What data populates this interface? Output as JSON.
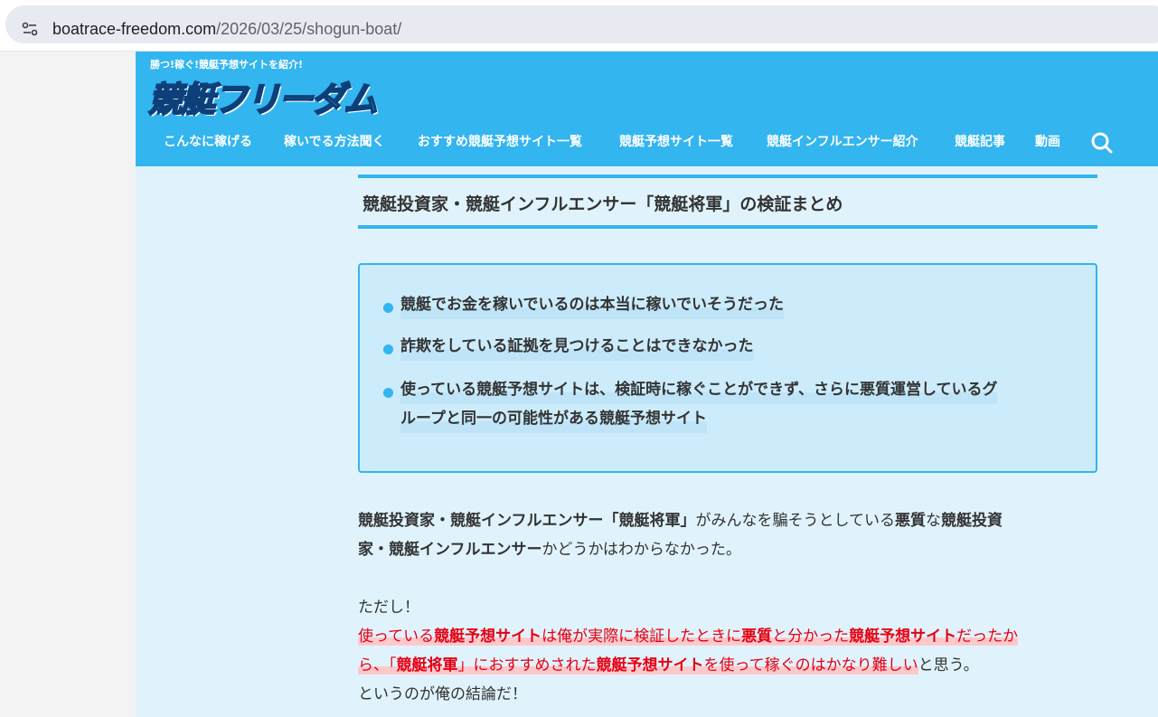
{
  "browser": {
    "url_host": "boatrace-freedom.com",
    "url_path": "/2026/03/25/shogun-boat/"
  },
  "site": {
    "tagline": "勝つ!稼ぐ!競艇予想サイトを紹介!",
    "logo_text_1": "競艇",
    "logo_text_2": "フリーダム",
    "nav": [
      {
        "label": "こんなに稼げる"
      },
      {
        "label": "稼いでる方法聞く"
      },
      {
        "label": "おすすめ競艇予想サイト一覧"
      },
      {
        "label": "競艇予想サイト一覧"
      },
      {
        "label": "競艇インフルエンサー紹介"
      },
      {
        "label": "競艇記事"
      },
      {
        "label": "動画"
      }
    ],
    "accent_color": "#33b5ef"
  },
  "article": {
    "heading": "競艇投資家・競艇インフルエンサー「競艇将軍」の検証まとめ",
    "summary": [
      "競艇でお金を稼いでいるのは本当に稼いでいそうだった",
      "詐欺をしている証拠を見つけることはできなかった",
      "使っている競艇予想サイトは、検証時に稼ぐことができず、さらに悪質運営しているグ",
      "ループと同一の可能性がある競艇予想サイト"
    ],
    "p1": {
      "a": "競艇投資家・競艇インフルエンサー「競艇将軍」",
      "b": "がみんなを騙そうとしている",
      "c": "悪質",
      "d": "な",
      "e": "競艇投資",
      "f": "家・競艇インフルエンサー",
      "g": "かどうかはわからなかった。"
    },
    "p2": {
      "l1": "ただし！",
      "a": "使っている",
      "b": "競艇予想サイト",
      "c": "は俺が実際に検証したときに",
      "d": "悪質",
      "e": "と分かった",
      "f": "競艇予想サイト",
      "g": "だったか",
      "h": "ら、「",
      "i": "競艇将軍",
      "j": "」におすすめされた",
      "k": "競艇予想サイト",
      "l": "を使って稼ぐのはかなり難しい",
      "m": "と思う。",
      "last": "というのが俺の結論だ！"
    }
  }
}
